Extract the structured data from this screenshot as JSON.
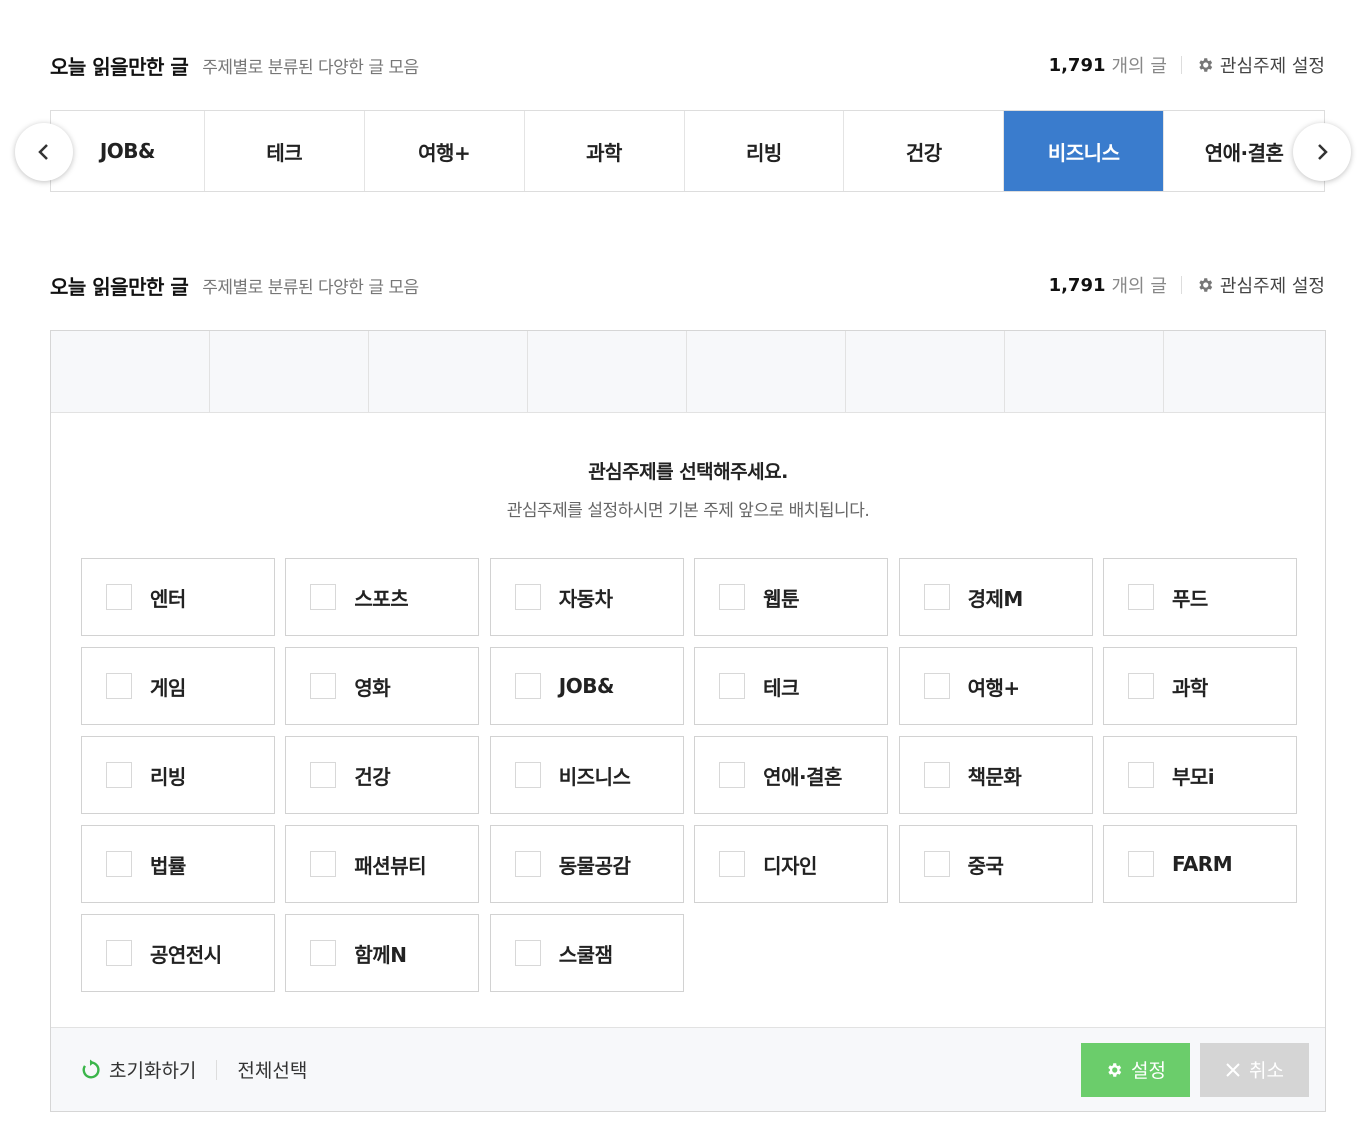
{
  "section1": {
    "title": "오늘 읽을만한 글",
    "subtitle": "주제별로 분류된 다양한 글 모음",
    "count": "1,791",
    "count_unit": "개의 글",
    "setting_label": "관심주제 설정"
  },
  "tabs": [
    "JOB&",
    "테크",
    "여행+",
    "과학",
    "리빙",
    "건강",
    "비즈니스",
    "연애·결혼"
  ],
  "active_tab": "비즈니스",
  "section2": {
    "title": "오늘 읽을만한 글",
    "subtitle": "주제별로 분류된 다양한 글 모음",
    "count": "1,791",
    "count_unit": "개의 글",
    "setting_label": "관심주제 설정"
  },
  "panel": {
    "message_title": "관심주제를 선택해주세요.",
    "message_desc": "관심주제를 설정하시면 기본 주제 앞으로 배치됩니다.",
    "topics": [
      "엔터",
      "스포츠",
      "자동차",
      "웹툰",
      "경제M",
      "푸드",
      "게임",
      "영화",
      "JOB&",
      "테크",
      "여행+",
      "과학",
      "리빙",
      "건강",
      "비즈니스",
      "연애·결혼",
      "책문화",
      "부모i",
      "법률",
      "패션뷰티",
      "동물공감",
      "디자인",
      "중국",
      "FARM",
      "공연전시",
      "함께N",
      "스쿨잼"
    ],
    "reset_label": "초기화하기",
    "select_all_label": "전체선택",
    "save_label": "설정",
    "cancel_label": "취소"
  },
  "colors": {
    "active_tab": "#3a7ccd",
    "save_button": "#6bcd6b",
    "cancel_button": "#d5d5d5",
    "reset_icon": "#3bb54a"
  },
  "icons": {
    "setting": "gear-icon",
    "prev": "chevron-left-icon",
    "next": "chevron-right-icon",
    "reset": "refresh-icon",
    "save": "gear-icon",
    "cancel": "close-icon"
  }
}
